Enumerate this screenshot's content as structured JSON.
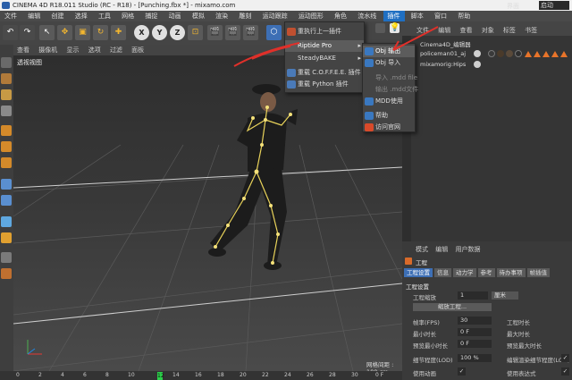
{
  "window": {
    "title": "CINEMA 4D R18.011 Studio (RC - R18) - [Punching.fbx *] - mixamo.com"
  },
  "menubar": [
    "文件",
    "编辑",
    "创建",
    "选择",
    "工具",
    "网格",
    "捕捉",
    "动画",
    "模拟",
    "渲染",
    "雕刻",
    "运动跟踪",
    "运动图形",
    "角色",
    "流水线",
    "插件",
    "脚本",
    "窗口",
    "帮助"
  ],
  "menubar_active": "插件",
  "toolbar": {
    "axis_x": "X",
    "axis_y": "Y",
    "axis_z": "Z"
  },
  "viewport": {
    "menu": [
      "查看",
      "摄像机",
      "显示",
      "选项",
      "过滤",
      "面板"
    ],
    "label": "透视视图",
    "grid_spacing": "网格间距 : 100 cm"
  },
  "plugins_menu": {
    "items": [
      "重执行上一插件",
      "Riptide Pro",
      "SteadyBAKE",
      "重载 C.O.F.F.E.E. 插件",
      "重载 Python 插件"
    ]
  },
  "riptide_submenu": {
    "items": [
      {
        "label": "Obj 输出",
        "disabled": false
      },
      {
        "label": "Obj 导入",
        "disabled": false
      },
      {
        "label": "导入 .mdd file",
        "disabled": true
      },
      {
        "label": "输出 .mdd文件",
        "disabled": true
      },
      {
        "label": "MDD使用",
        "disabled": false
      },
      {
        "label": "帮助",
        "disabled": false
      },
      {
        "label": "访问官网",
        "disabled": false
      }
    ]
  },
  "right_top": {
    "layout_label": "界面",
    "layout_value": "启动"
  },
  "object_manager": {
    "menu": [
      "文件",
      "编辑",
      "查看",
      "对象",
      "标签",
      "书签"
    ],
    "objects": [
      "Cinema4D_编辑器",
      "policeman01_aj",
      "mixamorig:Hips"
    ]
  },
  "attributes": {
    "menu": [
      "模式",
      "编辑",
      "用户数据"
    ],
    "section": "工程",
    "tabs": [
      "工程设置",
      "信息",
      "动力学",
      "参考",
      "待办事项",
      "帧插值"
    ],
    "tab_selected": "工程设置",
    "group_title": "工程设置",
    "fields": {
      "scale_label": "工程缩放",
      "scale_value": "1",
      "scale_unit": "厘米",
      "scale_button": "缩放工程...",
      "fps_label": "帧率(FPS)",
      "fps_value": "30",
      "mintime_label": "最小时长",
      "mintime_value": "0 F",
      "previewmin_label": "预览最小时长",
      "previewmin_value": "0 F",
      "lod_label": "细节程度(LOD)",
      "lod_value": "100 %",
      "anim_label": "使用动画",
      "projlen_label": "工程时长",
      "maxlen_label": "最大时长",
      "previewmax_label": "预览最大时长",
      "render_lod_label": "编辑渲染细节程度(LOD)",
      "expr_label": "使用表达式"
    }
  },
  "timeline": {
    "ticks": [
      "0",
      "2",
      "4",
      "6",
      "8",
      "10",
      "12",
      "14",
      "16",
      "18",
      "20",
      "22",
      "24",
      "26",
      "28",
      "30"
    ],
    "current": "12",
    "end": "0 F"
  },
  "colors": {
    "accent": "#1f6fc2",
    "annotation_arrow": "#e0302a",
    "marker": "#2bd04a"
  }
}
